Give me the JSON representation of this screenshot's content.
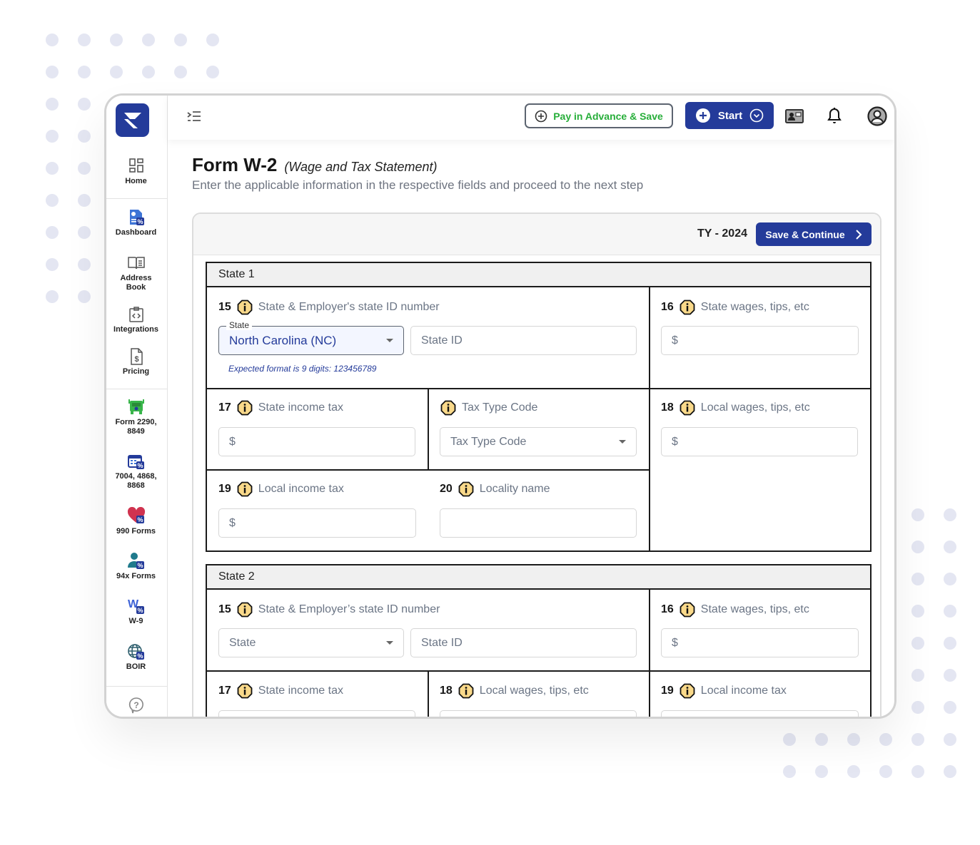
{
  "sidebar": {
    "logo_alt": "TaxZerone",
    "items": [
      {
        "label": "Home",
        "icon": "home-grid-icon"
      },
      {
        "label": "Dashboard",
        "icon": "dashboard-icon"
      },
      {
        "label": "Address Book",
        "icon": "address-book-icon"
      },
      {
        "label": "Integrations",
        "icon": "integrations-icon"
      },
      {
        "label": "Pricing",
        "icon": "pricing-icon"
      },
      {
        "label": "Form 2290, 8849",
        "icon": "truck-icon"
      },
      {
        "label": "7004, 4868, 8868",
        "icon": "calendar-icon"
      },
      {
        "label": "990 Forms",
        "icon": "heart-icon"
      },
      {
        "label": "94x Forms",
        "icon": "person-icon"
      },
      {
        "label": "W-9",
        "icon": "w9-icon"
      },
      {
        "label": "BOIR",
        "icon": "globe-icon"
      }
    ],
    "help_icon": "help-icon"
  },
  "topbar": {
    "pay_advance_label": "Pay in Advance & Save",
    "start_label": "Start",
    "colors": {
      "brand": "#243b9a",
      "pay_text": "#27ae3a"
    }
  },
  "page": {
    "title": "Form W-2",
    "title_sub": "(Wage and Tax Statement)",
    "description": "Enter the applicable information in the respective fields and proceed to the next step"
  },
  "card": {
    "tax_year": "TY - 2024",
    "save_continue_label": "Save & Continue"
  },
  "state1": {
    "title": "State 1",
    "box15": {
      "num": "15",
      "label": "State & Employer's state ID number",
      "state_float_label": "State",
      "state_value": "North Carolina (NC)",
      "state_id_placeholder": "State ID",
      "hint": "Expected format is 9 digits: 123456789"
    },
    "box16": {
      "num": "16",
      "label": "State wages, tips, etc",
      "placeholder": "$"
    },
    "box17": {
      "num": "17",
      "label": "State income tax",
      "placeholder": "$"
    },
    "taxtype": {
      "label": "Tax Type Code",
      "placeholder": "Tax Type Code"
    },
    "box18": {
      "num": "18",
      "label": "Local wages, tips, etc",
      "placeholder": "$"
    },
    "box19": {
      "num": "19",
      "label": "Local income tax",
      "placeholder": "$"
    },
    "box20": {
      "num": "20",
      "label": "Locality name",
      "placeholder": ""
    }
  },
  "state2": {
    "title": "State 2",
    "box15": {
      "num": "15",
      "label": "State & Employer’s state ID number",
      "state_placeholder": "State",
      "state_id_placeholder": "State ID"
    },
    "box16": {
      "num": "16",
      "label": "State wages, tips, etc",
      "placeholder": "$"
    },
    "box17": {
      "num": "17",
      "label": "State income tax"
    },
    "box18": {
      "num": "18",
      "label": "Local wages, tips, etc"
    },
    "box19": {
      "num": "19",
      "label": "Local income tax"
    }
  }
}
